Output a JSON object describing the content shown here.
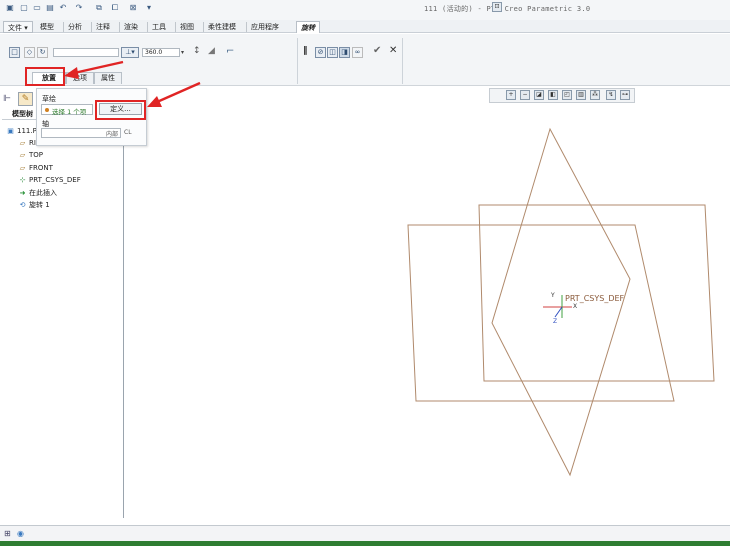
{
  "window": {
    "title": "111 (活动的) - PTC Creo Parametric 3.0"
  },
  "quick_access": {
    "icons": [
      "app-icon",
      "new-icon",
      "open-icon",
      "save-icon",
      "undo-icon",
      "redo-icon",
      "regenerate-icon",
      "windows-icon",
      "close-window-icon",
      "customize-icon"
    ]
  },
  "menu": {
    "items": [
      "文件 ▾",
      "模型",
      "分析",
      "注释",
      "渲染",
      "工具",
      "视图",
      "柔性建模",
      "应用程序",
      "旋转"
    ]
  },
  "ribbon": {
    "angle_value": "360.0",
    "tabs": [
      "放置",
      "选项",
      "属性"
    ]
  },
  "dashboard": {
    "sketch_label": "草绘",
    "sketch_status": "选择 1 个项",
    "define_button": "定义...",
    "axis_label": "轴",
    "axis_internal": "内部",
    "axis_cl": "CL"
  },
  "model_tree": {
    "tab_label": "模型树",
    "items": [
      {
        "label": "111.P",
        "icon": "part-icon"
      },
      {
        "label": "RI",
        "icon": "datum-plane-icon"
      },
      {
        "label": "TOP",
        "icon": "datum-plane-icon"
      },
      {
        "label": "FRONT",
        "icon": "datum-plane-icon"
      },
      {
        "label": "PRT_CSYS_DEF",
        "icon": "csys-icon"
      },
      {
        "label": "在此插入",
        "icon": "insert-here-icon"
      },
      {
        "label": "旋转 1",
        "icon": "revolve-icon"
      }
    ]
  },
  "graphics": {
    "csys_label": "PRT_CSYS_DEF",
    "axis_x": "X",
    "axis_y": "Y",
    "axis_z": "Z",
    "plane_color": "#b08a6c",
    "annotation_color": "#e02424"
  }
}
